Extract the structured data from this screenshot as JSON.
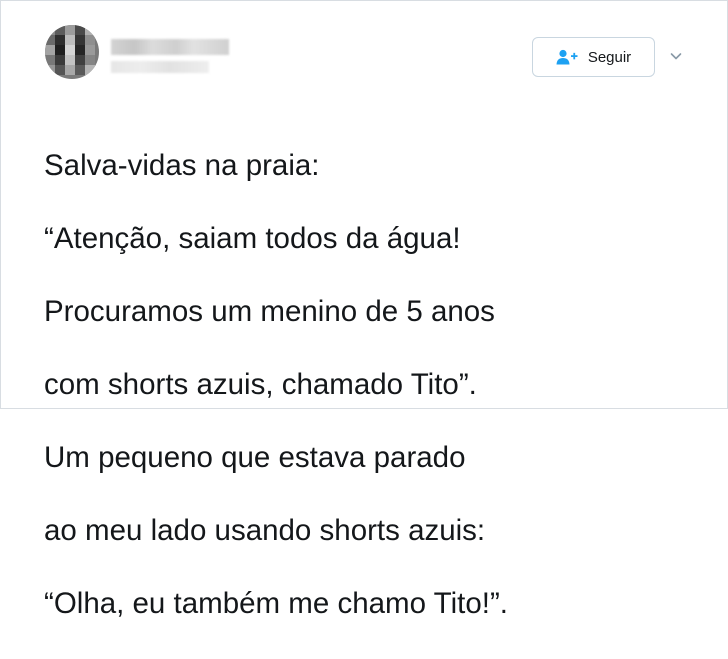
{
  "follow": {
    "label": "Seguir",
    "icon": "add-user-icon",
    "accent": "#1da1f2"
  },
  "menu": {
    "icon": "chevron-down-icon"
  },
  "tweet": {
    "lines": [
      "Salva-vidas na praia:",
      "“Atenção, saiam todos da água!",
      "Procuramos um menino de 5 anos",
      "com shorts azuis, chamado Tito”.",
      "Um pequeno que estava parado",
      "ao meu lado usando shorts azuis:",
      "“Olha, eu também me chamo Tito!”."
    ]
  }
}
